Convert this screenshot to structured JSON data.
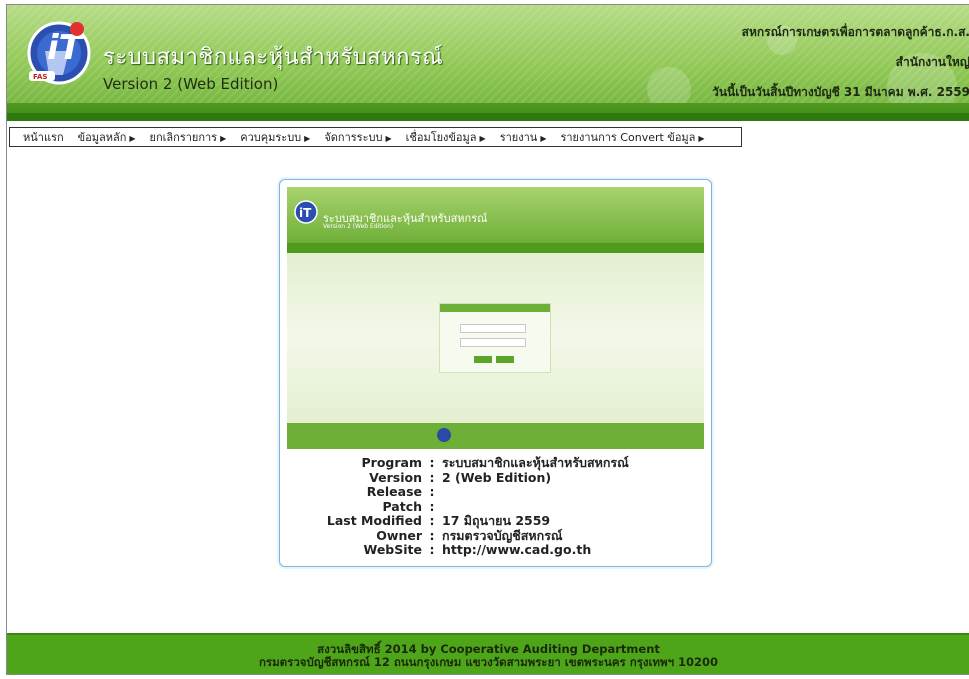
{
  "header": {
    "app_title": "ระบบสมาชิกและหุ้นสำหรับสหกรณ์",
    "app_version": "Version 2 (Web Edition)",
    "org_name": "สหกรณ์การเกษตรเพื่อการตลาดลูกค้าธ.ก.ส.",
    "office": "สำนักงานใหญ่",
    "fiscal_date": "วันนี้เป็นวันสิ้นปีทางบัญชี 31 มีนาคม พ.ศ. 2559",
    "logo_badge": "FAS",
    "colors": {
      "header_green": "#8fc754",
      "band_green": "#3d8a16"
    }
  },
  "menu": {
    "items": [
      {
        "label": "หน้าแรก",
        "has_submenu": false
      },
      {
        "label": "ข้อมูลหลัก",
        "has_submenu": true
      },
      {
        "label": "ยกเลิกรายการ",
        "has_submenu": true
      },
      {
        "label": "ควบคุมระบบ",
        "has_submenu": true
      },
      {
        "label": "จัดการระบบ",
        "has_submenu": true
      },
      {
        "label": "เชื่อมโยงข้อมูล",
        "has_submenu": true
      },
      {
        "label": "รายงาน",
        "has_submenu": true
      },
      {
        "label": "รายงานการ Convert ข้อมูล",
        "has_submenu": true
      }
    ]
  },
  "preview": {
    "title": "ระบบสมาชิกและหุ้นสำหรับสหกรณ์",
    "subtitle": "Version 2 (Web Edition)"
  },
  "info": {
    "rows": [
      {
        "key": "Program",
        "value": "ระบบสมาชิกและหุ้นสำหรับสหกรณ์"
      },
      {
        "key": "Version",
        "value": "2 (Web Edition)"
      },
      {
        "key": "Release",
        "value": ""
      },
      {
        "key": "Patch",
        "value": ""
      },
      {
        "key": "Last Modified",
        "value": "17 มิถุนายน 2559"
      },
      {
        "key": "Owner",
        "value": "กรมตรวจบัญชีสหกรณ์"
      },
      {
        "key": "WebSite",
        "value": "http://www.cad.go.th"
      }
    ],
    "separator": ":"
  },
  "footer": {
    "line1": "สงวนลิขสิทธิ์ 2014 by Cooperative Auditing Department",
    "line2": "กรมตรวจบัญชีสหกรณ์ 12 ถนนกรุงเกษม แขวงวัดสามพระยา เขตพระนคร กรุงเทพฯ 10200",
    "color": "#4ea51a"
  }
}
